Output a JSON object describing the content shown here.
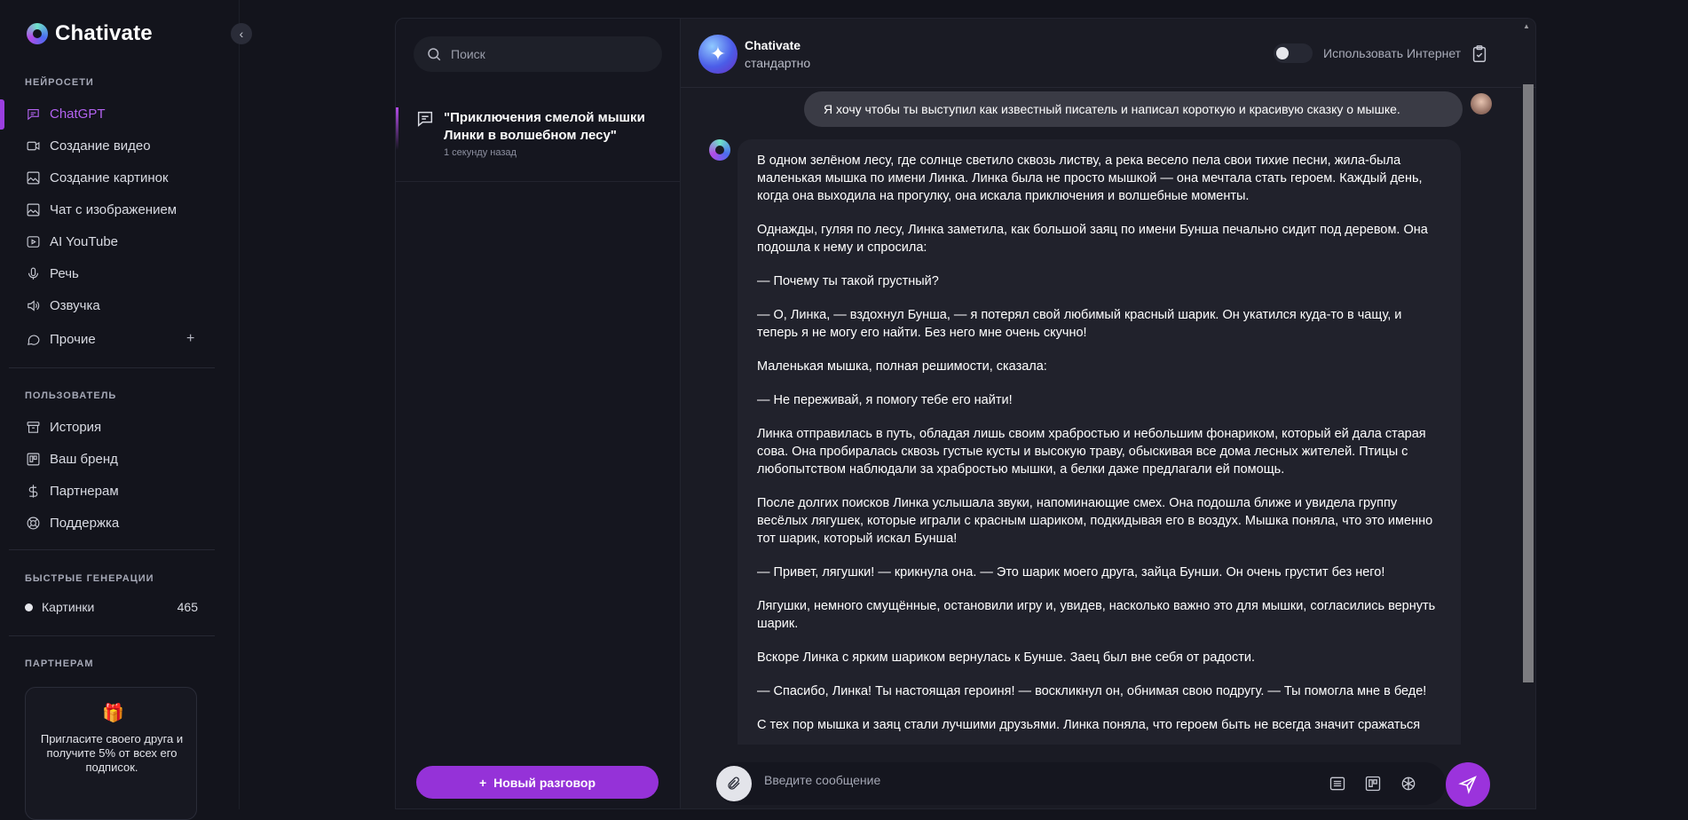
{
  "app": {
    "name": "Chativate"
  },
  "sidebar": {
    "section_networks": "НЕЙРОСЕТИ",
    "networks": [
      {
        "label": "ChatGPT",
        "icon": "chat-bubble-icon",
        "active": true
      },
      {
        "label": "Создание видео",
        "icon": "video-camera-icon"
      },
      {
        "label": "Создание картинок",
        "icon": "image-icon"
      },
      {
        "label": "Чат с изображением",
        "icon": "image-chat-icon"
      },
      {
        "label": "AI YouTube",
        "icon": "youtube-icon"
      },
      {
        "label": "Речь",
        "icon": "microphone-icon"
      },
      {
        "label": "Озвучка",
        "icon": "speaker-icon"
      },
      {
        "label": "Прочие",
        "icon": "message-circle-icon"
      }
    ],
    "more_plus": "+",
    "section_user": "ПОЛЬЗОВАТЕЛЬ",
    "user_items": [
      {
        "label": "История",
        "icon": "archive-icon"
      },
      {
        "label": "Ваш бренд",
        "icon": "brand-board-icon"
      },
      {
        "label": "Партнерам",
        "icon": "dollar-icon"
      },
      {
        "label": "Поддержка",
        "icon": "lifebuoy-icon"
      }
    ],
    "section_quick": "БЫСТРЫЕ ГЕНЕРАЦИИ",
    "quick": {
      "label": "Картинки",
      "count": "465"
    },
    "section_partners": "ПАРТНЕРАМ",
    "promo": {
      "icon": "gift-icon",
      "text": "Пригласите своего друга и получите 5% от всех его подписок."
    },
    "accent_color": "#9b3fe0"
  },
  "chats": {
    "search_placeholder": "Поиск",
    "items": [
      {
        "title": "\"Приключения смелой мышки Линки в волшебном лесу\"",
        "time": "1 секунду назад"
      }
    ],
    "new_chat_label": "Новый разговор"
  },
  "conversation": {
    "bot_name": "Chativate",
    "bot_mode": "стандартно",
    "internet_label": "Использовать Интернет",
    "internet_enabled": false,
    "user_message": "Я хочу чтобы ты выступил как известный писатель и написал короткую и красивую сказку о мышке.",
    "assistant_paragraphs": [
      "В одном зелёном лесу, где солнце светило сквозь листву, а река весело пела свои тихие песни, жила-была маленькая мышка по имени Линка. Линка была не просто мышкой — она мечтала стать героем. Каждый день, когда она выходила на прогулку, она искала приключения и волшебные моменты.",
      "Однажды, гуляя по лесу, Линка заметила, как большой заяц по имени Бунша печально сидит под деревом. Она подошла к нему и спросила:",
      "— Почему ты такой грустный?",
      "— О, Линка, — вздохнул Бунша, — я потерял свой любимый красный шарик. Он укатился куда-то в чащу, и теперь я не могу его найти. Без него мне очень скучно!",
      "Маленькая мышка, полная решимости, сказала:",
      "— Не переживай, я помогу тебе его найти!",
      "Линка отправилась в путь, обладая лишь своим храбростью и небольшим фонариком, который ей дала старая сова. Она пробиралась сквозь густые кусты и высокую траву, обыскивая все дома лесных жителей. Птицы с любопытством наблюдали за храбростью мышки, а белки даже предлагали ей помощь.",
      "После долгих поисков Линка услышала звуки, напоминающие смех. Она подошла ближе и увидела группу весёлых лягушек, которые играли с красным шариком, подкидывая его в воздух. Мышка поняла, что это именно тот шарик, который искал Бунша!",
      "— Привет, лягушки! — крикнула она. — Это шарик моего друга, зайца Бунши. Он очень грустит без него!",
      "Лягушки, немного смущённые, остановили игру и, увидев, насколько важно это для мышки, согласились вернуть шарик.",
      "Вскоре Линка с ярким шариком вернулась к Бунше. Заец был вне себя от радости.",
      "— Спасибо, Линка! Ты настоящая героиня! — воскликнул он, обнимая свою подругу. — Ты помогла мне в беде!",
      "С тех пор мышка и заяц стали лучшими друзьями. Линка поняла, что героем быть не всегда значит сражаться"
    ],
    "composer_placeholder": "Введите сообщение",
    "send_color": "#9b33dc"
  }
}
